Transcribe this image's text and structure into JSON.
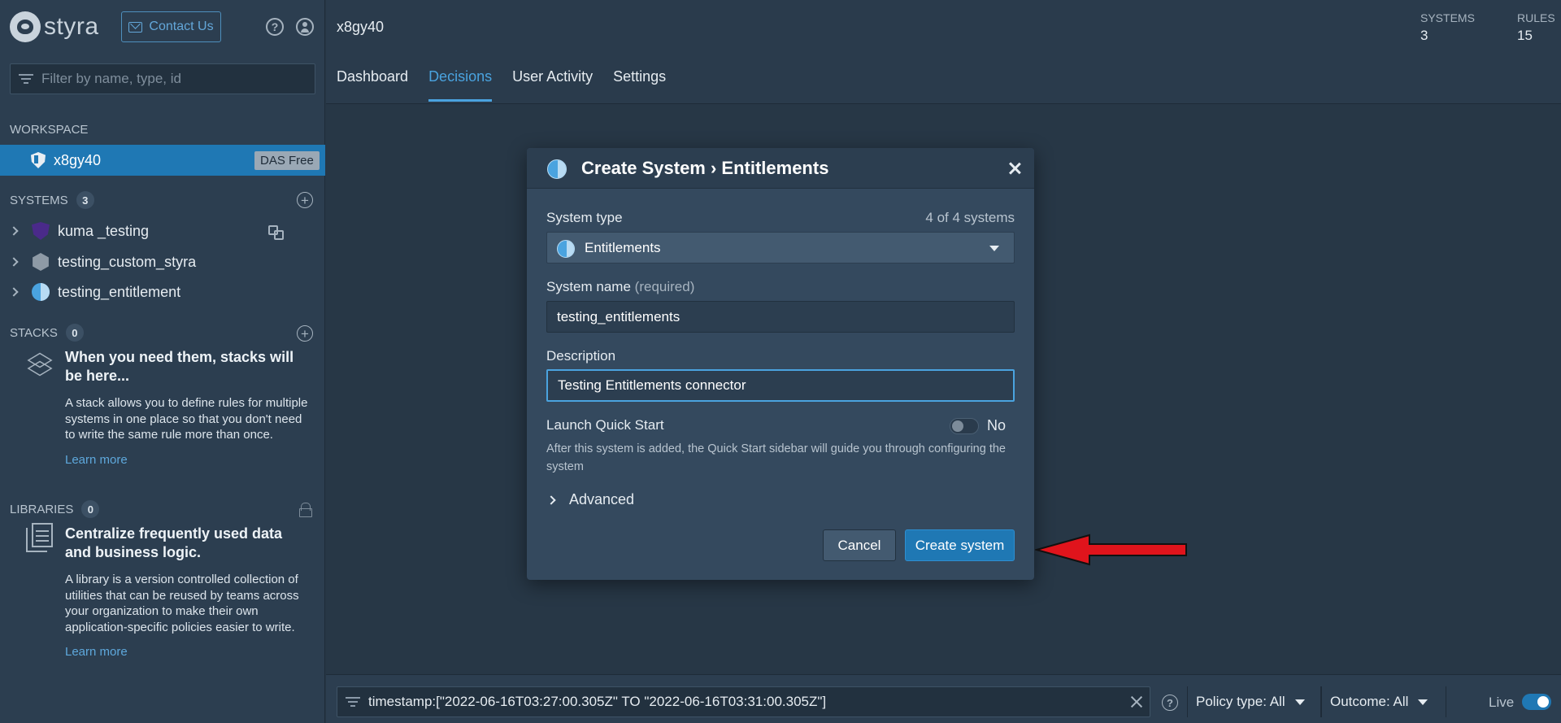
{
  "sidebar": {
    "logo_text": "styra",
    "contact_label": "Contact Us",
    "filter_placeholder": "Filter by name, type, id",
    "workspace": {
      "label": "WORKSPACE",
      "name": "x8gy40",
      "badge": "DAS Free"
    },
    "systems": {
      "label": "SYSTEMS",
      "count": "3",
      "items": [
        {
          "name": "kuma _testing",
          "icon": "kuma-icon"
        },
        {
          "name": "testing_custom_styra",
          "icon": "custom-system-icon"
        },
        {
          "name": "testing_entitlement",
          "icon": "entitlements-icon"
        }
      ]
    },
    "stacks": {
      "label": "STACKS",
      "count": "0",
      "empty_title": "When you need them, stacks will be here...",
      "empty_desc": "A stack allows you to define rules for multiple systems in one place so that you don't need to write the same rule more than once.",
      "learn_more": "Learn more"
    },
    "libraries": {
      "label": "LIBRARIES",
      "count": "0",
      "empty_title": "Centralize frequently used data and business logic.",
      "empty_desc": "A library is a version controlled collection of utilities that can be reused by teams across your organization to make their own application-specific policies easier to write.",
      "learn_more": "Learn more"
    }
  },
  "header": {
    "workspace_title": "x8gy40",
    "stats": [
      {
        "label": "SYSTEMS",
        "value": "3"
      },
      {
        "label": "RULES",
        "value": "15"
      }
    ],
    "tabs": [
      {
        "label": "Dashboard",
        "active": false
      },
      {
        "label": "Decisions",
        "active": true
      },
      {
        "label": "User Activity",
        "active": false
      },
      {
        "label": "Settings",
        "active": false
      }
    ]
  },
  "modal": {
    "title": "Create System › Entitlements",
    "system_type_label": "System type",
    "system_type_count": "4 of 4 systems",
    "system_type_value": "Entitlements",
    "system_name_label": "System name",
    "system_name_required": "(required)",
    "system_name_value": "testing_entitlements",
    "description_label": "Description",
    "description_value": "Testing Entitlements connector",
    "quick_start_label": "Launch Quick Start",
    "quick_start_value": "No",
    "quick_start_help": "After this system is added, the Quick Start sidebar will guide you through configuring the system",
    "advanced_label": "Advanced",
    "cancel_label": "Cancel",
    "create_label": "Create system"
  },
  "bottom_bar": {
    "filter_value": "timestamp:[\"2022-06-16T03:27:00.305Z\" TO \"2022-06-16T03:31:00.305Z\"]",
    "policy_type": "Policy type: All",
    "outcome": "Outcome: All",
    "live_label": "Live",
    "live_on": true
  },
  "colors": {
    "accent": "#1f78b4",
    "link": "#4aa3df",
    "arrow": "#e0141c"
  }
}
